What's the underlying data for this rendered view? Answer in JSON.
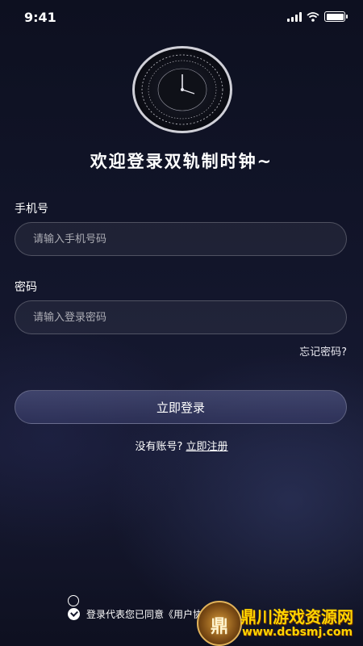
{
  "status_bar": {
    "time": "9:41"
  },
  "welcome_title": "欢迎登录双轨制时钟~",
  "phone": {
    "label": "手机号",
    "placeholder": "请输入手机号码"
  },
  "password": {
    "label": "密码",
    "placeholder": "请输入登录密码"
  },
  "forgot_password": "忘记密码?",
  "login_button": "立即登录",
  "register": {
    "prompt": "没有账号?",
    "link": "立即注册"
  },
  "agreement": {
    "text": "登录代表您已同意《用户协议》《"
  },
  "watermark": {
    "emblem": "鼎",
    "title": "鼎川游戏资源网",
    "url": "www.dcbsmj.com"
  }
}
